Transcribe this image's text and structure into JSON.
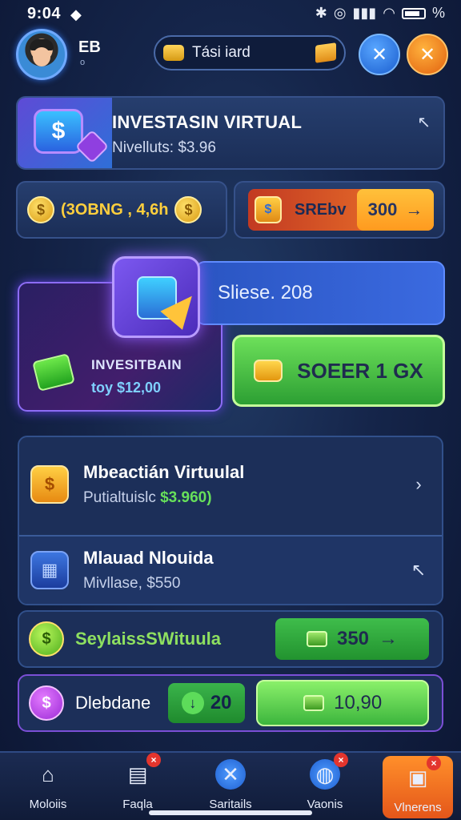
{
  "status_bar": {
    "time": "9:04",
    "icons": [
      "shield-check-icon",
      "bluetooth-icon",
      "target-icon",
      "signal-icon",
      "wifi-icon",
      "battery-icon"
    ],
    "battery_pct": "%"
  },
  "header": {
    "initials": "EB",
    "sub": "o",
    "search_text": "Tási iard"
  },
  "invest_card": {
    "title": "INVESTASIN VIRTUAL",
    "subtitle": "Nivelluts: $3.96"
  },
  "coins_card": {
    "text": "(3OBNG , 4,6h"
  },
  "spin_card": {
    "label": "SREbv",
    "value": "300"
  },
  "feature": {
    "title": "INVESITBAIN",
    "subtitle": "toy $12,00"
  },
  "savings": {
    "text": "Sliese. 208"
  },
  "green_button": {
    "label": "SOEER 1 GX"
  },
  "list": [
    {
      "title": "Mbeactián Virtuulal",
      "sub_prefix": "Putialtuislc",
      "sub_value": "$3.960)"
    },
    {
      "title": "Mlauad Nlouida",
      "sub_prefix": "Mivllase,",
      "sub_value": "$550"
    }
  ],
  "row_green": {
    "label": "SeylaissSWituula",
    "value": "350"
  },
  "row_purple": {
    "label": "Dlebdane",
    "deposit_value": "20",
    "balance_value": "10,90"
  },
  "bottom_nav": [
    {
      "label": "Moloiis",
      "icon": "home-icon",
      "badge": ""
    },
    {
      "label": "Faqla",
      "icon": "document-icon",
      "badge": "×"
    },
    {
      "label": "Saritails",
      "icon": "tools-icon",
      "badge": ""
    },
    {
      "label": "Vaonis",
      "icon": "globe-icon",
      "badge": "×"
    },
    {
      "label": "Vlnerens",
      "icon": "gift-icon",
      "badge": "×"
    }
  ],
  "colors": {
    "background": "#15254a",
    "accent_blue": "#2a62e0",
    "accent_green": "#3cb53d",
    "accent_orange": "#e4561a",
    "accent_purple": "#8b5cf6"
  }
}
